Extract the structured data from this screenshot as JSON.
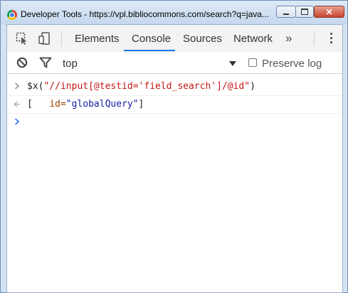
{
  "window": {
    "title": "Developer Tools - https://vpl.bibliocommons.com/search?q=java...",
    "close_glyph": "✕"
  },
  "toolbar": {
    "tabs": [
      "Elements",
      "Console",
      "Sources",
      "Network"
    ],
    "active_tab": "Console",
    "more_tabs": "»"
  },
  "filter": {
    "context": "top",
    "preserve_log_label": "Preserve log",
    "preserve_log_checked": false
  },
  "console": {
    "input_prefix": "$x(",
    "input_string": "\"//input[@testid='field_search']/@id\"",
    "input_suffix": ")",
    "output_open": "[",
    "output_attr": "id=",
    "output_value": "\"globalQuery\"",
    "output_close": "]"
  },
  "colors": {
    "accent": "#1a73e8",
    "string": "#c41a16",
    "attr": "#994500",
    "value": "#1a1aa6"
  }
}
